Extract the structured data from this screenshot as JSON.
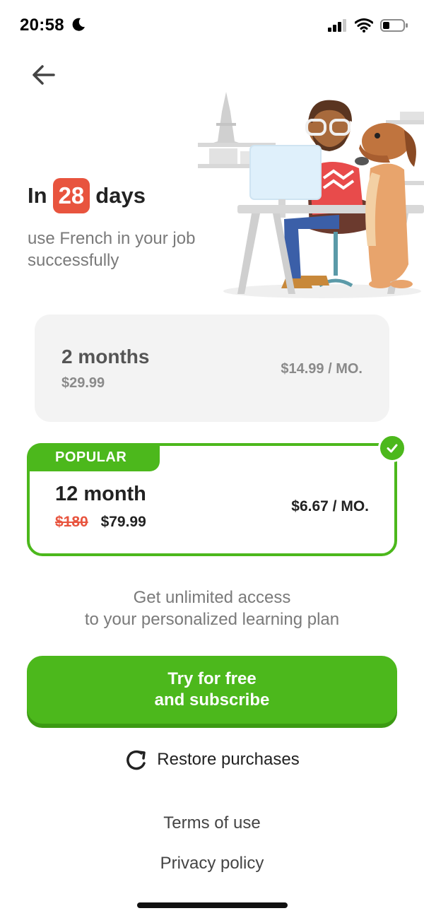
{
  "status_bar": {
    "time": "20:58"
  },
  "hero": {
    "headline_prefix": "In",
    "headline_number": "28",
    "headline_suffix": "days",
    "subhead": "use French in your job successfully"
  },
  "plans": [
    {
      "title": "2 months",
      "price": "$29.99",
      "per_month": "$14.99 / MO."
    },
    {
      "badge": "POPULAR",
      "title": "12 month",
      "old_price": "$180",
      "price": "$79.99",
      "per_month": "$6.67 / MO.",
      "selected": true
    }
  ],
  "access_text": {
    "line1": "Get unlimited access",
    "line2": "to your personalized learning plan"
  },
  "cta": {
    "line1": "Try for free",
    "line2": "and subscribe"
  },
  "restore_label": "Restore purchases",
  "links": {
    "terms": "Terms of use",
    "privacy": "Privacy policy"
  },
  "colors": {
    "accent_green": "#4cb81c",
    "badge_red": "#e8543e",
    "muted_text": "#7a7a7a"
  }
}
